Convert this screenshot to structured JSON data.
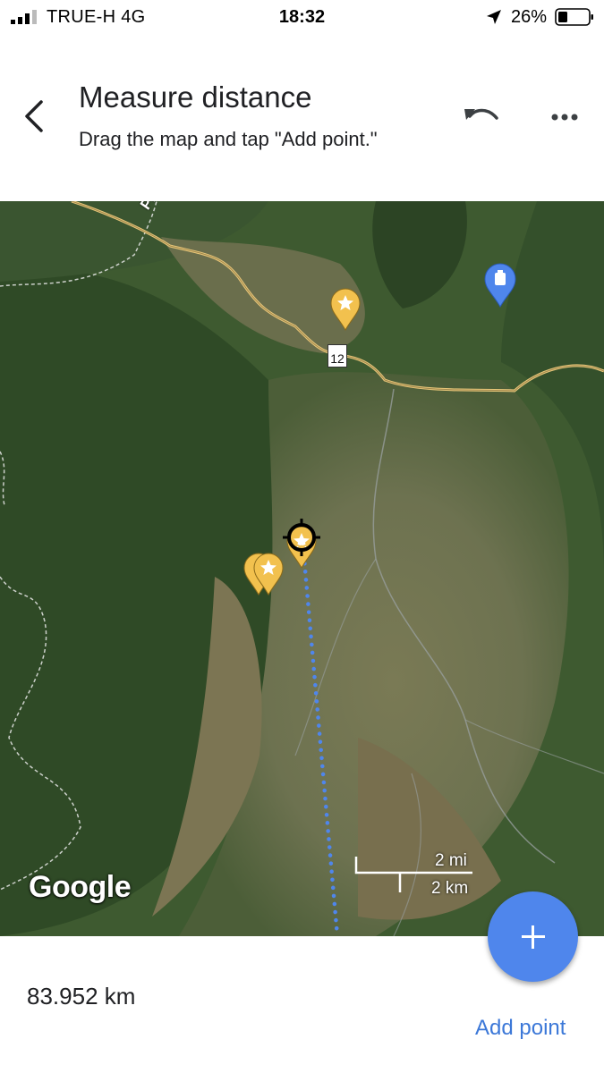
{
  "status_bar": {
    "carrier": "TRUE-H  4G",
    "time": "18:32",
    "battery": "26%"
  },
  "header": {
    "title": "Measure distance",
    "subtitle": "Drag the map and tap \"Add point.\"",
    "back_icon": "chevron-left-icon",
    "undo_icon": "undo-icon",
    "more_icon": "more-horizontal-icon"
  },
  "map": {
    "road_label": "PHE",
    "route_shield": "12",
    "scale_mi": "2 mi",
    "scale_km": "2 km",
    "attribution": "Google",
    "colors": {
      "measure_line": "#4f86ec",
      "road": "#e8c77a",
      "star_pin": "#f2c14e",
      "hotel_pin": "#4f86ec"
    }
  },
  "bottom": {
    "distance": "83.952 km",
    "add_point_label": "Add point",
    "fab_icon": "plus-icon"
  }
}
